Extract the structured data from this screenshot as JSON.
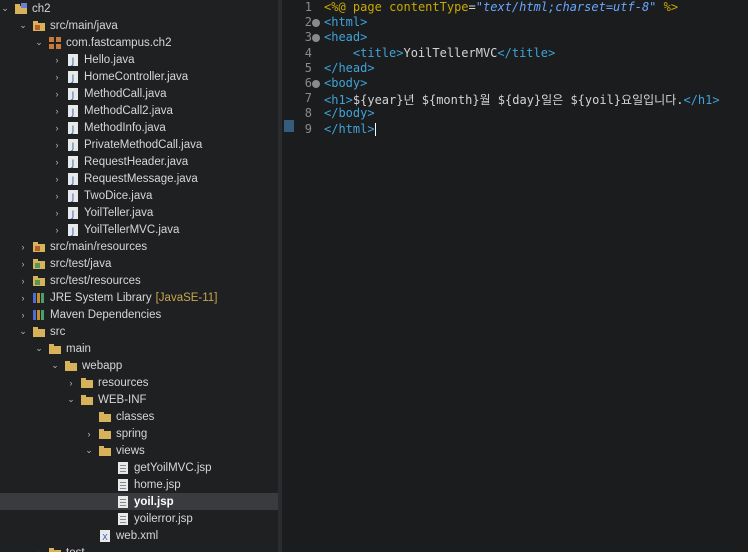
{
  "tree": {
    "items": [
      {
        "label": "ch2",
        "icon": "project-icon",
        "chevron": "down"
      },
      {
        "label": "src/main/java",
        "icon": "source-folder-icon",
        "chevron": "down"
      },
      {
        "label": "com.fastcampus.ch2",
        "icon": "package-icon",
        "chevron": "down"
      },
      {
        "label": "Hello.java",
        "icon": "java-file-icon",
        "chevron": "right"
      },
      {
        "label": "HomeController.java",
        "icon": "java-file-icon",
        "chevron": "right"
      },
      {
        "label": "MethodCall.java",
        "icon": "java-file-icon",
        "chevron": "right"
      },
      {
        "label": "MethodCall2.java",
        "icon": "java-file-icon",
        "chevron": "right"
      },
      {
        "label": "MethodInfo.java",
        "icon": "java-file-icon",
        "chevron": "right"
      },
      {
        "label": "PrivateMethodCall.java",
        "icon": "java-file-icon",
        "chevron": "right"
      },
      {
        "label": "RequestHeader.java",
        "icon": "java-file-icon",
        "chevron": "right"
      },
      {
        "label": "RequestMessage.java",
        "icon": "java-file-icon",
        "chevron": "right"
      },
      {
        "label": "TwoDice.java",
        "icon": "java-file-icon",
        "chevron": "right"
      },
      {
        "label": "YoilTeller.java",
        "icon": "java-file-icon",
        "chevron": "right"
      },
      {
        "label": "YoilTellerMVC.java",
        "icon": "java-file-icon",
        "chevron": "right"
      },
      {
        "label": "src/main/resources",
        "icon": "source-folder-icon",
        "chevron": "right"
      },
      {
        "label": "src/test/java",
        "icon": "test-folder-icon",
        "chevron": "right"
      },
      {
        "label": "src/test/resources",
        "icon": "test-folder-icon",
        "chevron": "right"
      },
      {
        "label": "JRE System Library",
        "icon": "library-icon",
        "chevron": "right",
        "suffix": "[JavaSE-11]"
      },
      {
        "label": "Maven Dependencies",
        "icon": "library-icon",
        "chevron": "right"
      },
      {
        "label": "src",
        "icon": "folder-icon",
        "chevron": "down"
      },
      {
        "label": "main",
        "icon": "folder-icon",
        "chevron": "down"
      },
      {
        "label": "webapp",
        "icon": "folder-icon",
        "chevron": "down"
      },
      {
        "label": "resources",
        "icon": "folder-icon",
        "chevron": "right"
      },
      {
        "label": "WEB-INF",
        "icon": "folder-icon",
        "chevron": "down"
      },
      {
        "label": "classes",
        "icon": "folder-icon",
        "chevron": "none"
      },
      {
        "label": "spring",
        "icon": "folder-icon",
        "chevron": "right"
      },
      {
        "label": "views",
        "icon": "folder-icon",
        "chevron": "down"
      },
      {
        "label": "getYoilMVC.jsp",
        "icon": "jsp-file-icon",
        "chevron": "none"
      },
      {
        "label": "home.jsp",
        "icon": "jsp-file-icon",
        "chevron": "none"
      },
      {
        "label": "yoil.jsp",
        "icon": "jsp-file-icon",
        "chevron": "none",
        "selected": true
      },
      {
        "label": "yoilerror.jsp",
        "icon": "jsp-file-icon",
        "chevron": "none"
      },
      {
        "label": "web.xml",
        "icon": "xml-file-icon",
        "chevron": "none"
      },
      {
        "label": "test",
        "icon": "folder-icon",
        "chevron": "right"
      }
    ]
  },
  "editor": {
    "lines": [
      {
        "n": "1",
        "html": "<span class='deltag'>&lt;%@</span> <span class='kw'>page</span> <span class='kw'>contentType</span>=<span class='str'>\"text/html;charset=utf-8\"</span> <span class='deltag'>%&gt;</span>",
        "fold": false
      },
      {
        "n": "2",
        "html": "<span class='tag'>&lt;html&gt;</span>",
        "fold": true
      },
      {
        "n": "3",
        "html": "<span class='tag'>&lt;head&gt;</span>",
        "fold": true
      },
      {
        "n": "4",
        "html": "    <span class='tag'>&lt;title&gt;</span>YoilTellerMVC<span class='tag'>&lt;/title&gt;</span>",
        "fold": false
      },
      {
        "n": "5",
        "html": "<span class='tag'>&lt;/head&gt;</span>",
        "fold": false
      },
      {
        "n": "6",
        "html": "<span class='tag'>&lt;body&gt;</span>",
        "fold": true
      },
      {
        "n": "7",
        "html": "<span class='tag'>&lt;h1&gt;</span>${year}년 ${month}월 ${day}일은 ${yoil}요일입니다.<span class='tag'>&lt;/h1&gt;</span>",
        "fold": false
      },
      {
        "n": "8",
        "html": "<span class='tag'>&lt;/body&gt;</span>",
        "fold": false
      },
      {
        "n": "9",
        "html": "<span class='tag'>&lt;/html&gt;</span><span class='caret'></span>",
        "fold": false
      }
    ]
  },
  "colors": {
    "tag": "#3fa3d8",
    "keyword": "#c9a800",
    "string": "#6aa6ff",
    "selection": "#3a3b3e"
  }
}
